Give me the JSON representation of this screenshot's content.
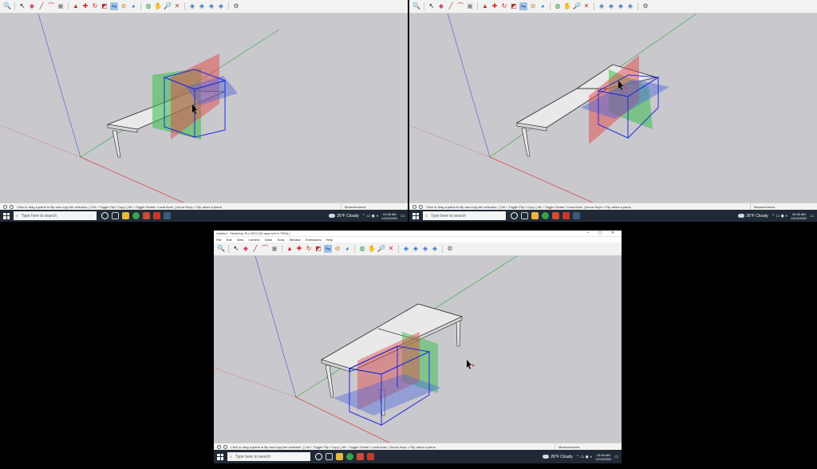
{
  "window_title": "Untitled - SketchUp Pro 2022 (30 days left in TRIAL)",
  "window_controls": "– ▢ ✕",
  "menu": [
    "File",
    "Edit",
    "View",
    "Camera",
    "Draw",
    "Tools",
    "Window",
    "Extensions",
    "Help"
  ],
  "status_hint": "Click or drag a plane to flip and copy the selection. [ Ctrl = Toggle Flip / Copy. [ Alt = Toggle Global / Local Axes. ] Arrow Keys = Flip about a plane.",
  "measurements_label": "Measurements",
  "taskbar": {
    "search_placeholder": "Type here to search",
    "weather": "26°F Cloudy",
    "time": "10:46 AM",
    "date": "12/13/2022"
  },
  "toolbar_icons": [
    "magnifier-icon",
    "select-arrow-icon",
    "eraser-icon",
    "pencil-icon",
    "arc-icon",
    "shape-icon",
    "pushpull-icon",
    "move-icon",
    "rotate-icon",
    "scale-icon",
    "offset-icon",
    "flip-icon",
    "tape-icon",
    "paint-icon",
    "orbit-icon",
    "pan-icon",
    "zoom-icon",
    "zoom-extents-icon",
    "warehouse-icon",
    "extension-warehouse-icon",
    "layout-icon",
    "sketchup-icon"
  ],
  "colors": {
    "viewport_bg": "#c9c8cd",
    "selection_blue": "#1e2bd8",
    "plane_red": "#e23b3b",
    "plane_green": "#2fbf3d",
    "plane_blue": "#3d5bd9",
    "taskbar": "#202a36"
  }
}
